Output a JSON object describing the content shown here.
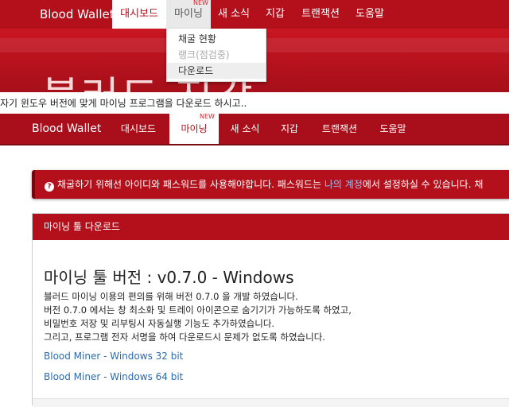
{
  "top_nav": {
    "brand": "Blood Wallet",
    "items": [
      {
        "label": "대시보드"
      },
      {
        "label": "마이닝",
        "badge": "NEW"
      },
      {
        "label": "새 소식"
      },
      {
        "label": "지갑"
      },
      {
        "label": "트랜잭션"
      },
      {
        "label": "도움말"
      }
    ]
  },
  "hero": {
    "title": "블러드 지갑"
  },
  "dropdown": {
    "items": [
      {
        "label": "채굴 현황"
      },
      {
        "label": "랭크(점검중)"
      },
      {
        "label": "다운로드"
      }
    ]
  },
  "instruction": "자기 윈도우 버전에 맞게 마이닝 프로그램을 다운로드 하시고..",
  "nav2": {
    "brand": "Blood Wallet",
    "items": [
      {
        "label": "대시보드"
      },
      {
        "label": "마이닝",
        "badge": "NEW"
      },
      {
        "label": "새 소식"
      },
      {
        "label": "지갑"
      },
      {
        "label": "트랜잭션"
      },
      {
        "label": "도움말"
      }
    ]
  },
  "alert": {
    "icon": "question-circle-icon",
    "text_before": "채굴하기 위해선 아이디와 패스워드를 사용해야합니다. 패스워드는 ",
    "link": "나의 계정",
    "text_after": "에서 설정하실 수 있습니다. 채"
  },
  "panel": {
    "heading": "마이닝 툴 다운로드",
    "version_title": "마이닝 툴 버전 : v0.7.0 - Windows",
    "description": [
      "블러드 마이닝 이용의 편의를 위해 버전 0.7.0 을 개발 하였습니다.",
      "버전 0.7.0 에서는 창 최소화 및 트레이 아이콘으로 숨기기가 가능하도록 하였고,",
      "비밀번호 저장 및 리부팅시 자동실행 기능도 추가하였습니다.",
      "그리고, 프로그램 전자 서명을 하여 다운로드시 문제가 없도록 하였습니다."
    ],
    "links": [
      {
        "label": "Blood Miner - Windows 32 bit"
      },
      {
        "label": "Blood Miner - Windows 64 bit"
      }
    ]
  },
  "colors": {
    "brand_red": "#b3101c",
    "link_blue": "#2a6aaf"
  }
}
